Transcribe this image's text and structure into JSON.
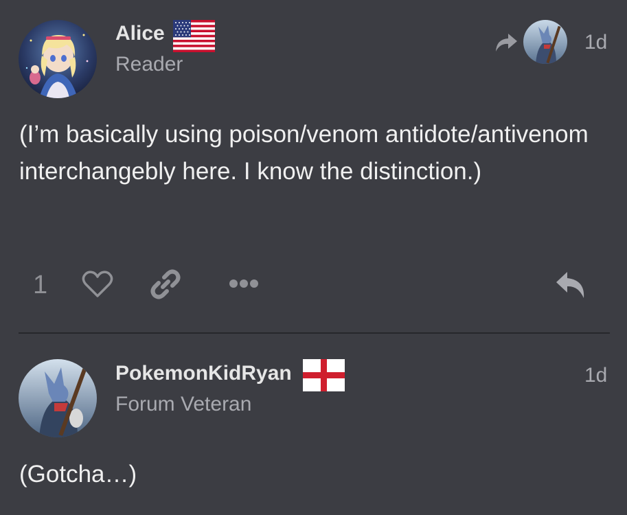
{
  "posts": [
    {
      "username": "Alice",
      "user_title": "Reader",
      "flag": "united-states-flag",
      "reply_to_indicator": "share-arrow-icon",
      "reply_to_avatar": "wolf-avatar",
      "date": "1d",
      "body": "(I’m basically using poison/venom antidote/antivenom interchangebly here. I know the distinction.)",
      "likes": "1"
    },
    {
      "username": "PokemonKidRyan",
      "user_title": "Forum Veteran",
      "flag": "england-flag",
      "date": "1d",
      "body": "(Gotcha…)"
    }
  ],
  "icons": {
    "like": "heart-icon",
    "link": "link-icon",
    "more": "ellipsis-icon",
    "reply": "reply-arrow-icon"
  },
  "colors": {
    "background": "#3c3d43",
    "text": "#f0f0f0",
    "muted": "#a9aab0",
    "divider": "#26272b"
  }
}
